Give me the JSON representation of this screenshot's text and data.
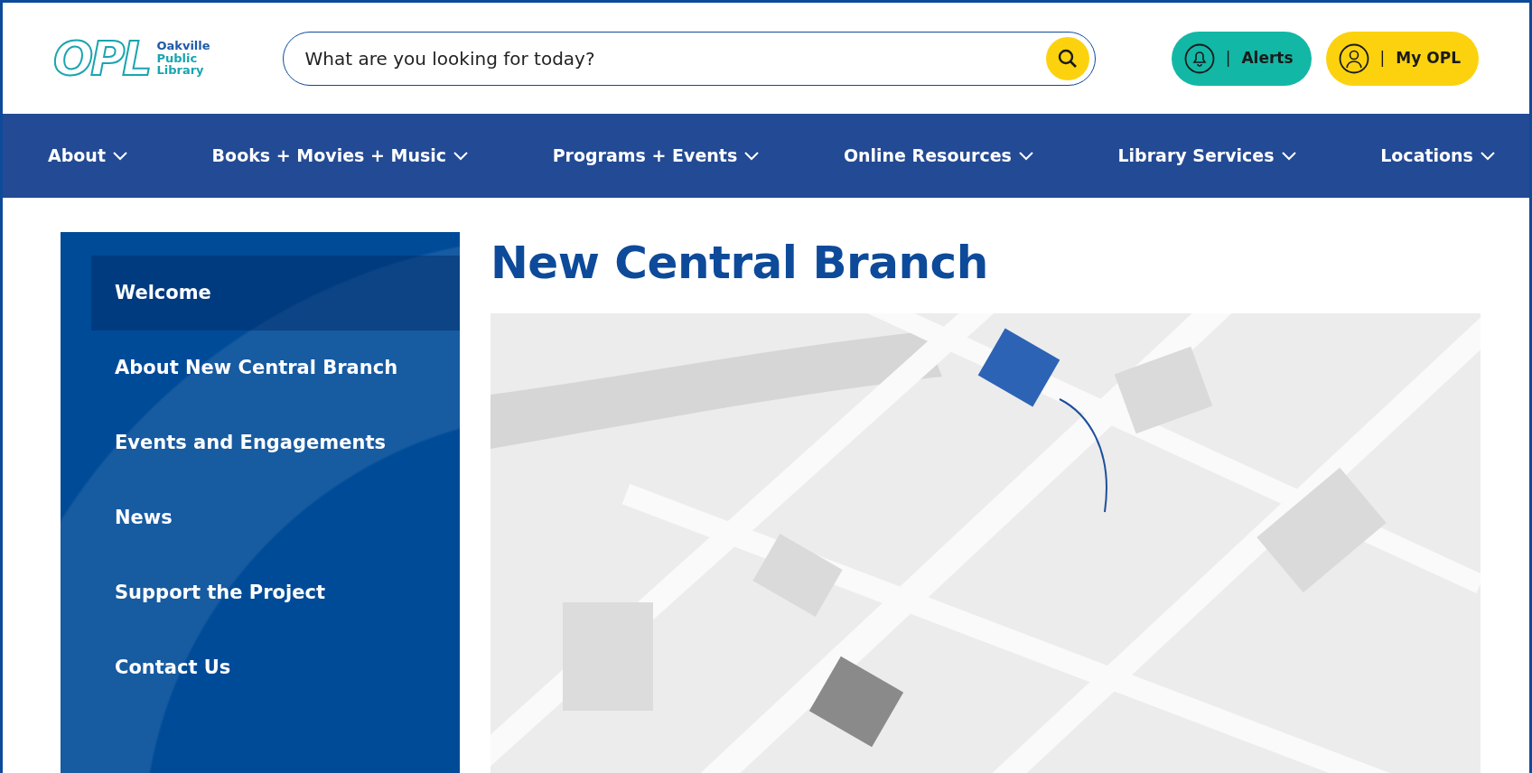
{
  "header": {
    "logo": {
      "mark": "OPL",
      "lines": [
        "Oakville",
        "Public",
        "Library"
      ]
    },
    "search": {
      "placeholder": "What are you looking for today?"
    },
    "buttons": [
      {
        "kind": "alerts",
        "separator": "|",
        "label": "Alerts"
      },
      {
        "kind": "account",
        "separator": "|",
        "label": "My OPL"
      }
    ]
  },
  "nav": [
    {
      "label": "About"
    },
    {
      "label": "Books + Movies + Music"
    },
    {
      "label": "Programs + Events"
    },
    {
      "label": "Online Resources"
    },
    {
      "label": "Library Services"
    },
    {
      "label": "Locations"
    }
  ],
  "sidebar": {
    "items": [
      {
        "label": "Welcome",
        "selected": true
      },
      {
        "label": "About New Central Branch",
        "selected": false
      },
      {
        "label": "Events and Engagements",
        "selected": false
      },
      {
        "label": "News",
        "selected": false
      },
      {
        "label": "Support the Project",
        "selected": false
      },
      {
        "label": "Contact Us",
        "selected": false
      }
    ]
  },
  "main": {
    "title": "New Central Branch"
  }
}
